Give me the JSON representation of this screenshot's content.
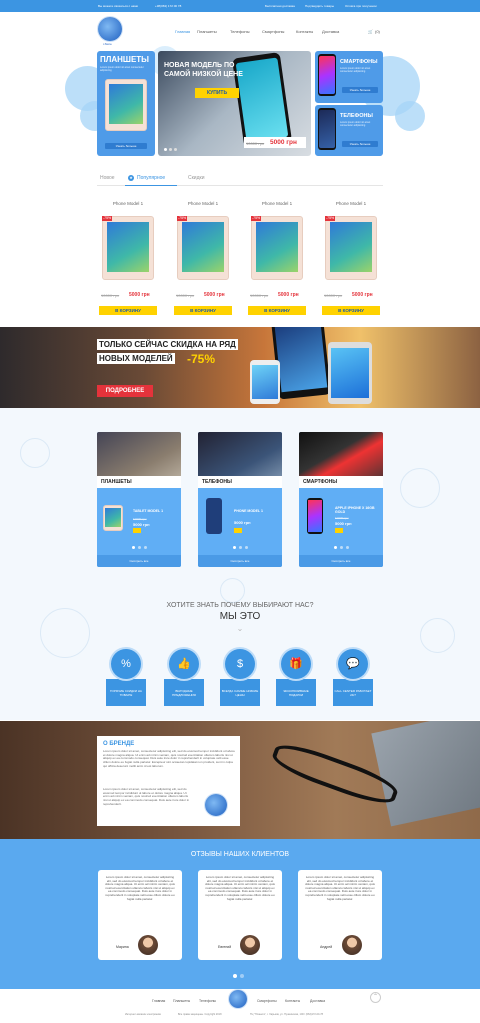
{
  "topbar": {
    "left": "Вы можете связаться с нами",
    "phone": "+38(063) 172 00 78",
    "links": [
      "Бесплатная доставка",
      "Подтвердить товары",
      "Оплата при получении"
    ]
  },
  "nav": {
    "logo": "i-Store",
    "links": [
      "Главная",
      "Планшеты",
      "Телефоны",
      "Смартфоны",
      "Контакты",
      "Доставка"
    ],
    "cart_count": "(0)"
  },
  "hero": {
    "left_title": "ПЛАНШЕТЫ",
    "left_sub": "Lorem ipsum dolor sit amet consectetur adipisicing",
    "left_btn": "Узнать больше",
    "main_title": "НОВАЯ МОДЕЛЬ ПО САМОЙ НИЗКОЙ ЦЕНЕ",
    "main_btn": "КУПИТЬ",
    "old": "10000 грн",
    "new": "5000 грн",
    "right1": "СМАРТФОНЫ",
    "right2": "ТЕЛЕФОНЫ",
    "right_sub": "Lorem ipsum dolor sit amet consectetur adipisicing",
    "right_btn": "Узнать больше"
  },
  "tabs": [
    "Новое",
    "Популярное",
    "Скидки"
  ],
  "products": [
    {
      "name": "Phone Model 1",
      "disc": "-75%",
      "old": "10000 грн",
      "new": "5000 грн",
      "btn": "В КОРЗИНУ"
    },
    {
      "name": "Phone Model 1",
      "disc": "-75%",
      "old": "10000 грн",
      "new": "5000 грн",
      "btn": "В КОРЗИНУ"
    },
    {
      "name": "Phone Model 1",
      "disc": "-75%",
      "old": "10000 грн",
      "new": "5000 грн",
      "btn": "В КОРЗИНУ"
    },
    {
      "name": "Phone Model 1",
      "disc": "-75%",
      "old": "10000 грн",
      "new": "5000 грн",
      "btn": "В КОРЗИНУ"
    }
  ],
  "banner": {
    "line1": "ТОЛЬКО СЕЙЧАС СКИДКА НА РЯД",
    "line2": "НОВЫХ МОДЕЛЕЙ",
    "pct": "-75%",
    "btn": "ПОДРОБНЕЕ"
  },
  "categories": [
    {
      "label": "ПЛАНШЕТЫ",
      "item": "TABLET MODEL 1",
      "old": "10000 грн",
      "new": "5000 грн",
      "btn": "Смотреть все"
    },
    {
      "label": "ТЕЛЕФОНЫ",
      "item": "PHONE MODEL 1",
      "old": "",
      "new": "5000 грн",
      "btn": "Смотреть все"
    },
    {
      "label": "СМАРТФОНЫ",
      "item": "APPLE IPHONE X 16GB GOLD",
      "old": "10000 грн",
      "new": "5000 грн",
      "btn": "Смотреть все"
    }
  ],
  "why": {
    "q": "ХОТИТЕ ЗНАТЬ ПОЧЕМУ ВЫБИРАЮТ НАС?",
    "a": "МЫ ЭТО",
    "items": [
      "ГОРЯЧИЕ СКИДКИ НА ТОВАРЫ",
      "ВЫГОДНЫЕ ПРЕДЛОЖЕНИЯ",
      "ВСЕГДА САМЫЕ НИЗКИЕ ЦЕНЫ",
      "ЭКСКЛЮЗИВНЫЕ ПОДАРКИ",
      "CALL CENTER РАБОТАЕТ 24/7"
    ]
  },
  "brand": {
    "title": "О БРЕНДЕ",
    "p1": "Lorem ipsum dolor sit amet, consectetur adipisicing elit, sed do eiusmod tempor incididunt ut labore et dolore magna aliqua. Ut enim ad minim veniam, quis nostrud exercitation ullamco laboris nisi ut aliquip ex ea commodo consequat. Duis aute irure dolor in reprehenderit in voluptate velit esse cillum dolore eu fugiat nulla pariatur. Excepteur sint occaecat cupidatat non proident, sunt in culpa qui officia deserunt mollit anim id est laborum.",
    "p2": "Lorem ipsum dolor sit amet, consectetur adipisicing elit, sed do eiusmod tempor incididunt ut labore et dolore magna aliqua. Ut enim ad minim veniam, quis nostrud exercitation ullamco laboris nisi ut aliquip ex ea commodo consequat. Duis aute irure dolor in reprehenderit."
  },
  "reviews": {
    "title": "ОТЗЫВЫ НАШИХ КЛИЕНТОВ",
    "text": "Lorem ipsum dolor sit amet, consectetur adipisicing elit, sed do eiusmod tempor incididunt ut labore et dolore magna aliqua. Ut enim ad minim veniam, quis nostrud exercitation ullamco laboris nisi ut aliquip ex ea commodo consequat. Duis aute irure dolor in reprehenderit in voluptate velit esse cillum dolore eu fugiat nulla pariatur.",
    "names": [
      "Марина",
      "Евгений",
      "Андрей"
    ]
  },
  "footer": {
    "links": [
      "Главная",
      "Планшеты",
      "Телефоны",
      "Смартфоны",
      "Контакты",
      "Доставка"
    ],
    "copy1": "Интернет-магазин электроники",
    "copy2": "Все права защищены. Copyright 2018",
    "addr": "ТЦ \"Планета\", г. Харьков, ул. Пушкинская, 100 / (063)172-00-78"
  }
}
